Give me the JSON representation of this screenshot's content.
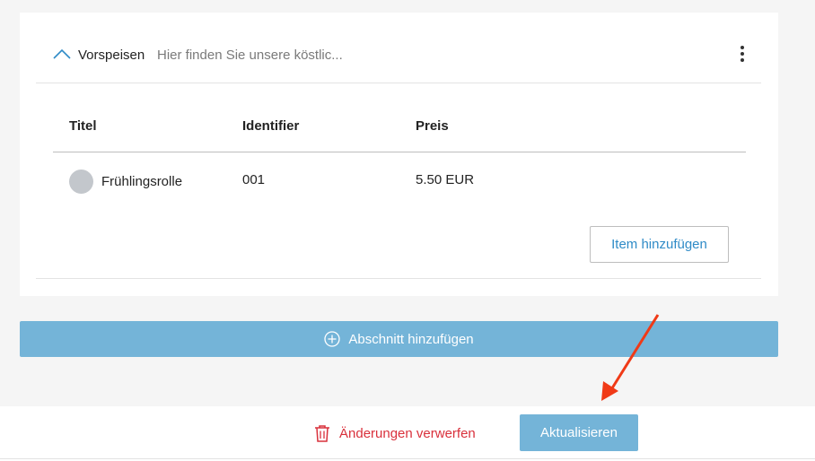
{
  "section": {
    "title": "Vorspeisen",
    "description": "Hier finden Sie unsere köstlic..."
  },
  "table": {
    "headers": {
      "title": "Titel",
      "identifier": "Identifier",
      "price": "Preis"
    },
    "rows": [
      {
        "title": "Frühlingsrolle",
        "identifier": "001",
        "price": "5.50 EUR"
      }
    ]
  },
  "buttons": {
    "add_item": "Item hinzufügen",
    "add_section": "Abschnitt hinzufügen",
    "discard": "Änderungen verwerfen",
    "update": "Aktualisieren"
  },
  "icons": {
    "collapse": "chevron-up-icon",
    "menu": "kebab-menu-icon",
    "add_section": "plus-circle-icon",
    "discard": "trash-icon"
  },
  "colors": {
    "primary": "#74b4d8",
    "link": "#2f8bc7",
    "danger": "#d9303b",
    "annotation": "#f03a17"
  }
}
